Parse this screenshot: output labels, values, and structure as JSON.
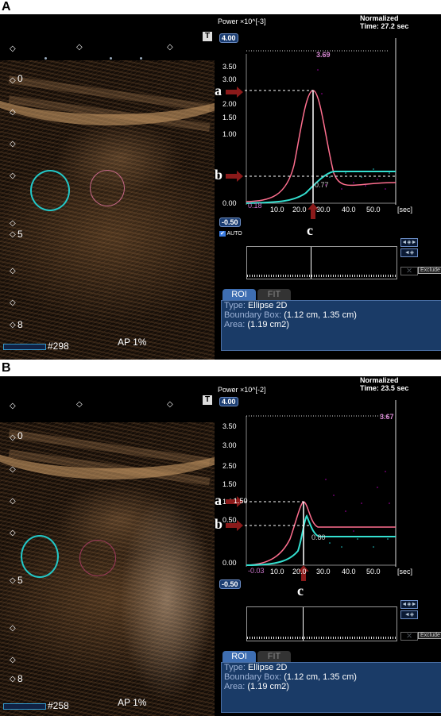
{
  "panels": [
    {
      "letter": "A",
      "depth_labels": [
        "0",
        "5",
        "8"
      ],
      "frame_number": "#298",
      "mode": "AP  1%",
      "graph": {
        "y_unit": "Power ×10^[-3]",
        "normalized": "Normalized",
        "time": "Time: 27.2 sec",
        "ymax_box": "4.00",
        "ymin_box": "-0.50",
        "yticks": [
          "3.50",
          "3.00",
          "2.50",
          "2.00",
          "1.50",
          "1.00",
          "0.50",
          "0.00"
        ],
        "xticks": [
          "10.0",
          "20.0",
          "30.0",
          "40.0",
          "50.0"
        ],
        "x_unit": "[sec]",
        "peak_label": "3.69",
        "low_label": "0.18",
        "mid_label": "0.77",
        "auto": "AUTO",
        "annotations": [
          "a",
          "b",
          "c"
        ]
      },
      "tabs": [
        "ROI",
        "FIT"
      ],
      "info": {
        "type_label": "Type:",
        "type_value": "Ellipse 2D",
        "box_label": "Boundary Box:",
        "box_value": "(1.12 cm, 1.35 cm)",
        "area_label": "Area:",
        "area_value": "(1.19 cm2)"
      },
      "buttons": [
        "Exclude"
      ],
      "colors": {
        "roi_cyan": "#22c8c8",
        "roi_pink": "#c86a8a",
        "curve_cyan": "#34e0d0",
        "curve_pink": "#ff6f8f",
        "arrow": "#8b1a1a"
      }
    },
    {
      "letter": "B",
      "depth_labels": [
        "0",
        "5",
        "8"
      ],
      "frame_number": "#258",
      "mode": "AP  1%",
      "graph": {
        "y_unit": "Power ×10^[-2]",
        "normalized": "Normalized",
        "time": "Time: 23.5 sec",
        "ymax_box": "4.00",
        "ymin_box": "-0.50",
        "yticks": [
          "3.50",
          "3.00",
          "2.50",
          "2.00",
          "1.50",
          "1.00",
          "0.50",
          "0.00"
        ],
        "xticks": [
          "10.0",
          "20.0",
          "30.0",
          "40.0",
          "50.0"
        ],
        "x_unit": "[sec]",
        "peak_label": "3.67",
        "low_label": "-0.03",
        "mid_label": "0.80",
        "peak_small": "1.50",
        "auto": "",
        "annotations": [
          "a",
          "b",
          "c"
        ]
      },
      "tabs": [
        "ROI",
        "FIT"
      ],
      "info": {
        "type_label": "Type:",
        "type_value": "Ellipse 2D",
        "box_label": "Boundary Box:",
        "box_value": "(1.12 cm, 1.35 cm)",
        "area_label": "Area:",
        "area_value": "(1.19 cm2)"
      },
      "buttons": [
        "Exclude"
      ],
      "colors": {
        "roi_cyan": "#22c8c8",
        "roi_pink": "#9a3a5a",
        "curve_cyan": "#34e0d0",
        "curve_pink": "#ff6f8f",
        "arrow": "#8b1a1a"
      }
    }
  ]
}
